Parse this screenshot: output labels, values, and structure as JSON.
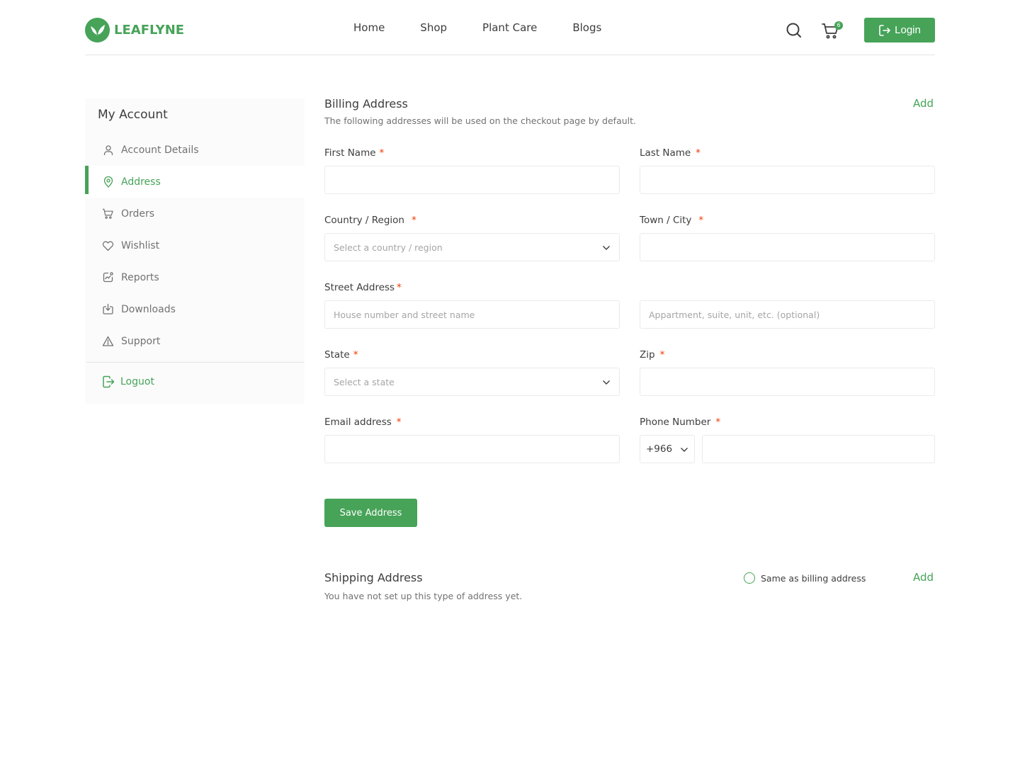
{
  "brand": {
    "name": "LEAFLYNE",
    "accent": "#46a358",
    "required_color": "#f03800"
  },
  "header": {
    "nav": [
      "Home",
      "Shop",
      "Plant Care",
      "Blogs"
    ],
    "cart_count": "6",
    "login_label": "Login"
  },
  "sidebar": {
    "title": "My Account",
    "items": [
      {
        "label": "Account Details",
        "icon": "user-icon",
        "active": false
      },
      {
        "label": "Address",
        "icon": "location-pin-icon",
        "active": true
      },
      {
        "label": "Orders",
        "icon": "cart-icon",
        "active": false
      },
      {
        "label": "Wishlist",
        "icon": "heart-icon",
        "active": false
      },
      {
        "label": "Reports",
        "icon": "chart-icon",
        "active": false
      },
      {
        "label": "Downloads",
        "icon": "download-icon",
        "active": false
      },
      {
        "label": "Support",
        "icon": "alert-icon",
        "active": false
      }
    ],
    "logout_label": "Loguot"
  },
  "billing": {
    "title": "Billing Address",
    "subtitle": "The following addresses will be used on the checkout page by default.",
    "add_label": "Add",
    "first_name": {
      "label": "First Name",
      "required": "*",
      "value": ""
    },
    "last_name": {
      "label": "Last Name",
      "required": "*",
      "value": ""
    },
    "country": {
      "label": "Country / Region",
      "required": "*",
      "placeholder": "Select a country / region"
    },
    "town": {
      "label": "Town / City",
      "required": "*",
      "value": ""
    },
    "street": {
      "label": "Street Address",
      "required": "*",
      "placeholder": "House number and street name"
    },
    "street2": {
      "placeholder": "Appartment, suite, unit, etc. (optional)"
    },
    "state": {
      "label": "State",
      "required": "*",
      "placeholder": "Select a state"
    },
    "zip": {
      "label": "Zip",
      "required": "*",
      "value": ""
    },
    "email": {
      "label": "Email address",
      "required": "*",
      "value": ""
    },
    "phone": {
      "label": "Phone Number",
      "required": "*",
      "code": "+966",
      "value": ""
    },
    "save_label": "Save Address"
  },
  "shipping": {
    "title": "Shipping Address",
    "subtitle": "You have not set up this type of address yet.",
    "same_as_billing_label": "Same as billing address",
    "add_label": "Add"
  }
}
